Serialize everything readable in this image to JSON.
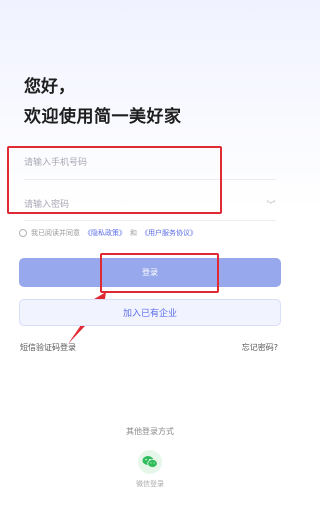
{
  "greeting": {
    "line1": "您好，",
    "line2": "欢迎使用简一美好家"
  },
  "form": {
    "phone_placeholder": "请输入手机号码",
    "password_placeholder": "请输入密码"
  },
  "agreement": {
    "prefix": "我已阅读并同意",
    "privacy": "《隐私政策》",
    "and": "和",
    "terms": "《用户服务协议》"
  },
  "buttons": {
    "login": "登录",
    "join_company": "加入已有企业"
  },
  "links": {
    "sms_login": "短信验证码登录",
    "forgot_password": "忘记密码?"
  },
  "other_login": {
    "title": "其他登录方式",
    "wechat_label": "微信登录",
    "wechat_icon": "wechat-icon"
  },
  "colors": {
    "accent": "#5b6ee8",
    "login_button": "#98a8ec",
    "annotation_red": "#e02a33",
    "wechat_green": "#2ebd5a"
  }
}
